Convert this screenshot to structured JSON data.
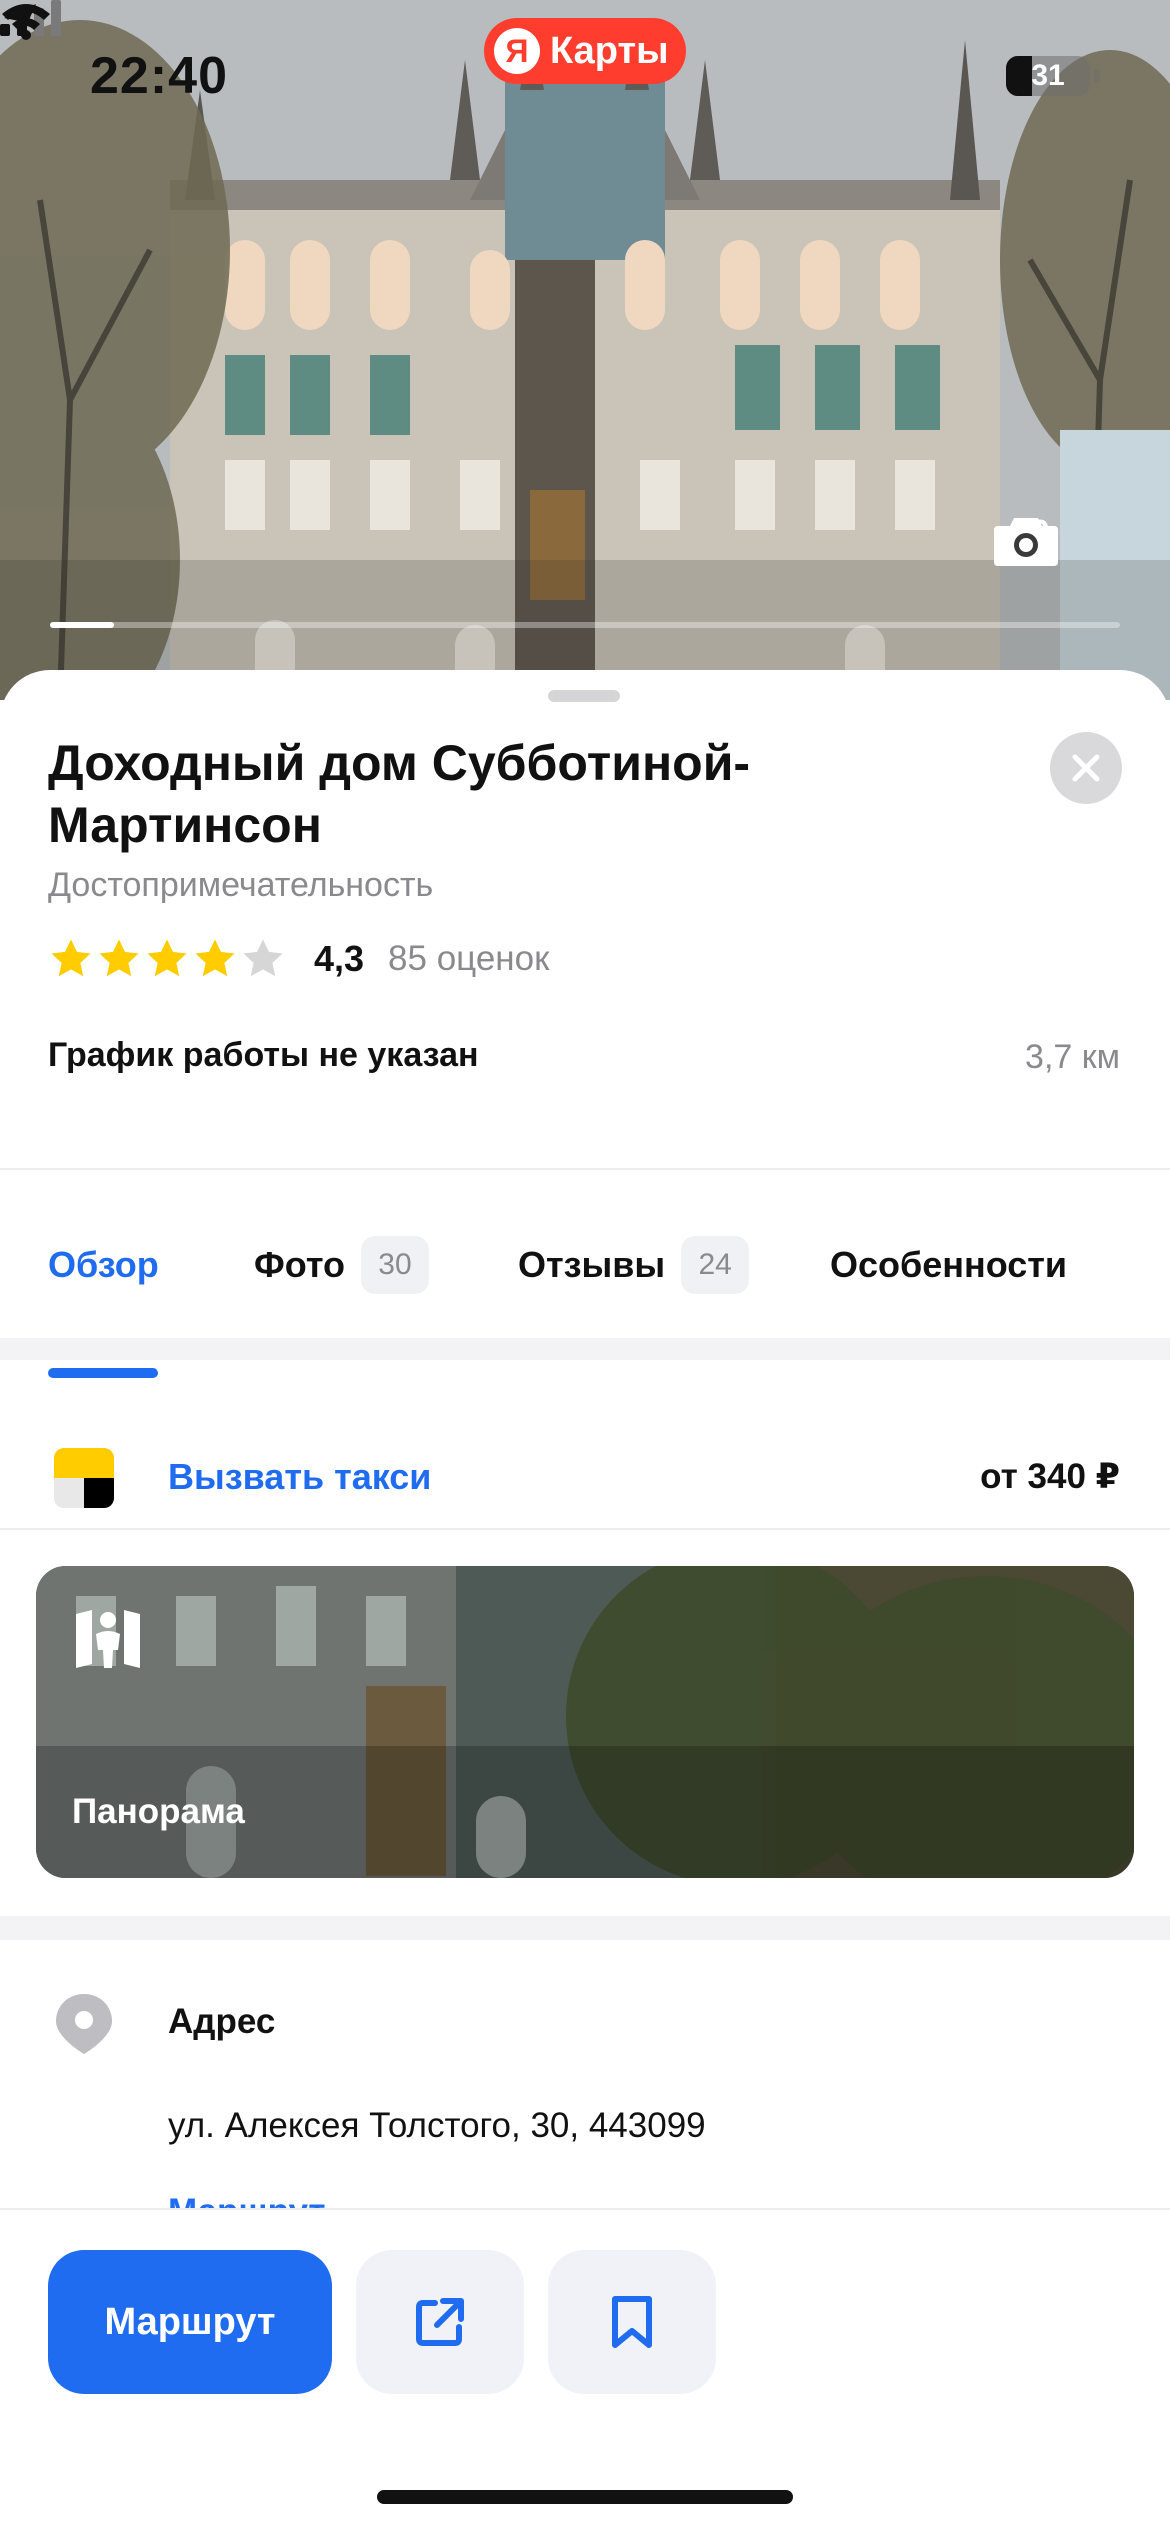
{
  "status_bar": {
    "time": "22:40",
    "app_pill_logo": "Я",
    "app_pill_label": "Карты",
    "battery_level": "31",
    "battery_fraction": 0.31,
    "icons": [
      "location-arrow-icon",
      "signal-icon",
      "wifi-icon",
      "battery-icon"
    ]
  },
  "hero": {
    "photo_count": "30",
    "photo_progress_fraction": 0.06
  },
  "place": {
    "title": "Доходный дом Субботиной-Мартинсон",
    "category": "Достопримечательность",
    "rating_value": "4,3",
    "rating_stars": 4.3,
    "rating_count": "85 оценок",
    "hours": "График работы не указан",
    "distance": "3,7 км"
  },
  "tabs": [
    {
      "label": "Обзор",
      "active": true
    },
    {
      "label": "Фото",
      "badge": "30"
    },
    {
      "label": "Отзывы",
      "badge": "24"
    },
    {
      "label": "Особенности"
    }
  ],
  "taxi": {
    "label": "Вызвать такси",
    "price": "от 340 ₽"
  },
  "panorama": {
    "label": "Панорама"
  },
  "address": {
    "title": "Адрес",
    "value": "ул. Алексея Толстого, 30, 443099",
    "route_link": "Маршрут"
  },
  "bottom_bar": {
    "route_label": "Маршрут",
    "share_icon": "share-icon",
    "bookmark_icon": "bookmark-icon"
  },
  "colors": {
    "accent": "#1f6cf0",
    "brand_red": "#ff3d2e",
    "star_yellow": "#ffcc00",
    "star_empty": "#d6d6d6"
  }
}
